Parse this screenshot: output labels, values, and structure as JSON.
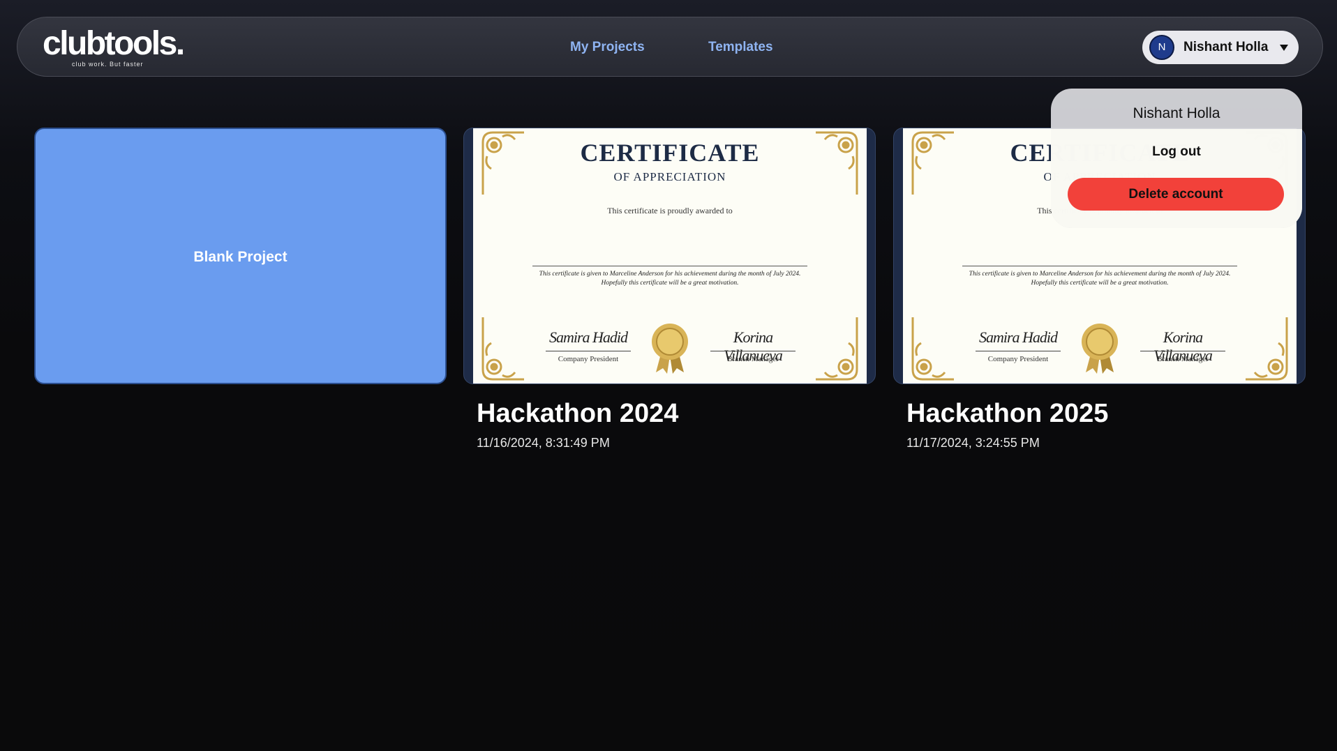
{
  "header": {
    "logo": {
      "word": "clubtools.",
      "tagline": "club work. But faster"
    },
    "nav": [
      {
        "label": "My Projects"
      },
      {
        "label": "Templates"
      }
    ],
    "user": {
      "initial": "N",
      "name": "Nishant Holla"
    }
  },
  "dropdown": {
    "name": "Nishant Holla",
    "logout_label": "Log out",
    "delete_label": "Delete account"
  },
  "blank_project": {
    "label": "Blank Project"
  },
  "certificate": {
    "title": "CERTIFICATE",
    "subtitle": "OF APPRECIATION",
    "awarded": "This certificate is proudly awarded to",
    "body": "This certificate is given to Marceline Anderson for his achievement during the month of July 2024. Hopefully this certificate will be a great motivation.",
    "sig_left_script": "Samira Hadid",
    "sig_left_role": "Company President",
    "sig_right_script": "Korina Villanueva",
    "sig_right_role": "Branch Manager"
  },
  "projects": [
    {
      "title": "Hackathon 2024",
      "date": "11/16/2024, 8:31:49 PM"
    },
    {
      "title": "Hackathon 2025",
      "date": "11/17/2024, 3:24:55 PM"
    }
  ],
  "colors": {
    "accent_blue": "#6a9cef",
    "nav_link": "#8fb4f2",
    "danger": "#f2413a",
    "gold": "#c9a24a"
  }
}
